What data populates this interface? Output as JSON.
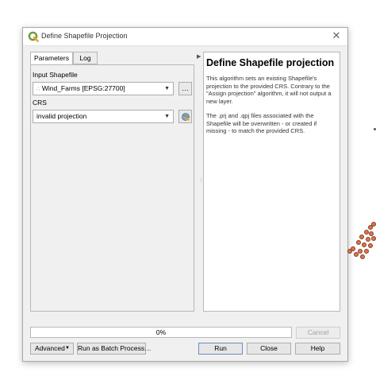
{
  "window": {
    "title": "Define Shapefile Projection"
  },
  "tabs": [
    {
      "label": "Parameters",
      "active": true
    },
    {
      "label": "Log",
      "active": false
    }
  ],
  "params": {
    "input_label": "Input Shapefile",
    "input_value": "Wind_Farms [EPSG:27700]",
    "input_browse_label": "…",
    "crs_label": "CRS",
    "crs_value": "invalid projection"
  },
  "help": {
    "title": "Define Shapefile projection",
    "para1": "This algorithm sets an existing Shapefile's projection to the provided CRS. Contrary to the \"Assign projection\" algorithm, it will not output a new layer.",
    "para2": "The .prj and .qpj files associated with the Shapefile will be overwritten - or created if missing - to match the provided CRS."
  },
  "progress": {
    "value": 0,
    "text": "0%"
  },
  "buttons": {
    "cancel": "Cancel",
    "advanced": "Advanced",
    "batch": "Run as Batch Process…",
    "run": "Run",
    "close": "Close",
    "help": "Help"
  },
  "colors": {
    "qgis_green": "#6e9a3d",
    "map_point": "#d97453"
  }
}
